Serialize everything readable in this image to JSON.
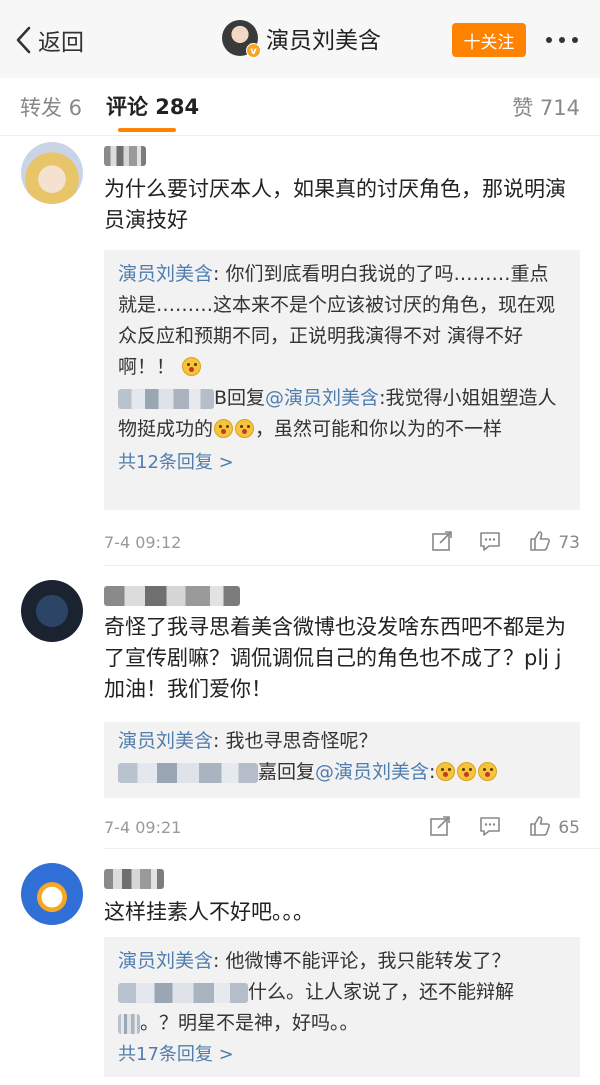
{
  "header": {
    "back_label": "返回",
    "author_name": "演员刘美含",
    "verified_badge": "v",
    "follow_label": "十关注"
  },
  "tabs": {
    "repost": "转发 6",
    "comments": "评论 284",
    "likes": "赞 714"
  },
  "colors": {
    "accent": "#ff8200",
    "link": "#507daf",
    "reply_bg": "#f2f2f2"
  },
  "comments": [
    {
      "text": "为什么要讨厌本人，如果真的讨厌角色，那说明演员演技好",
      "replies": [
        {
          "author": "演员刘美含",
          "sep": ": ",
          "text": "你们到底看明白我说的了吗………重点就是………这本来不是个应该被讨厌的角色，现在观众反应和预期不同，正说明我演得不对 演得不好啊！！"
        },
        {
          "author_suffix": "B回复",
          "mention": "@演员刘美含",
          "text": ":我觉得小姐姐塑造人物挺成功的",
          "text2": "，虽然可能和你以为的不一样"
        }
      ],
      "more_replies": "共12条回复 >",
      "time": "7-4 09:12",
      "likes": "73"
    },
    {
      "text": "奇怪了我寻思着美含微博也没发啥东西吧不都是为了宣传剧嘛？调侃调侃自己的角色也不成了？plj j加油！我们爱你！",
      "replies": [
        {
          "author": "演员刘美含",
          "sep": ": ",
          "text": "我也寻思奇怪呢？"
        },
        {
          "author_suffix": "嘉回复",
          "mention": "@演员刘美含",
          "text": ":"
        }
      ],
      "time": "7-4 09:21",
      "likes": "65"
    },
    {
      "text": "这样挂素人不好吧。。。",
      "replies": [
        {
          "author": "演员刘美含",
          "sep": ": ",
          "text": "他微博不能评论，我只能转发了？"
        },
        {
          "text": "什么。让人家说了，还不能辩解",
          "text2": "。？明星不是神，好吗。。"
        }
      ],
      "more_replies": "共17条回复 >"
    }
  ]
}
